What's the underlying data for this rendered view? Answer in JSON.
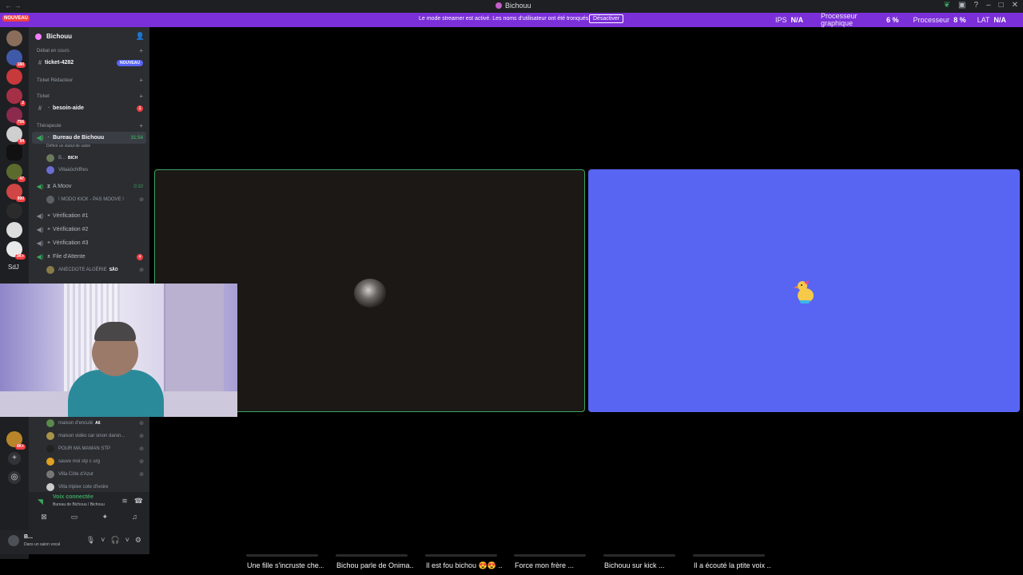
{
  "window": {
    "title": "Bichouu"
  },
  "streamer_bar": {
    "nouveau": "NOUVEAU",
    "message": "Le mode streamer est activé. Les noms d'utilisateur ont été tronqués.",
    "deactivate_label": "Désactiver",
    "stats": [
      {
        "label": "IPS",
        "value": "N/A"
      },
      {
        "label": "Processeur graphique",
        "value": "6 %"
      },
      {
        "label": "Processeur",
        "value": "8 %"
      },
      {
        "label": "LAT",
        "value": "N/A"
      }
    ]
  },
  "servers": {
    "badges": [
      "180",
      "2",
      "756",
      "94",
      "47",
      "990",
      "3K+",
      "4K+"
    ],
    "text_item": "SdJ"
  },
  "guild": {
    "name": "Bichouu",
    "categories": [
      {
        "name": "Débat en cours",
        "channels": [
          {
            "name": "ticket-4282",
            "badge": "NOUVEAU"
          }
        ]
      },
      {
        "name": "Ticket Rédacteur",
        "channels": []
      },
      {
        "name": "Ticket",
        "channels": [
          {
            "name": "besoin-aide",
            "badge": "1"
          }
        ]
      },
      {
        "name": "Thérapeute"
      }
    ],
    "voice": {
      "bureau": {
        "name": "Bureau de Bichouu",
        "time": "31:54",
        "status_hint": "Définir un statut de salon",
        "members": [
          {
            "name": "B...",
            "tag": "BICH"
          },
          {
            "name": "Villaáóchiffres"
          }
        ]
      },
      "amoov": {
        "name": "A Moov",
        "time": "0:10",
        "members": [
          {
            "name": "! MODO KICK - PAS MOOVE !"
          }
        ]
      },
      "verif1": "Vérification #1",
      "verif2": "Vérification #2",
      "verif3": "Vérification #3",
      "file": {
        "name": "File d'Attente",
        "badge": "4",
        "members": [
          {
            "name": "ANECDOTE ALGÉRIE",
            "tag": "SÃO"
          }
        ]
      }
    },
    "more_members": [
      {
        "name": "maison d'enculé",
        "tag": "A6"
      },
      {
        "name": "maison vidéo car sinon daron..."
      },
      {
        "name": "POUR MA MAMAN STP"
      },
      {
        "name": "sauve moi stp c urg"
      },
      {
        "name": "Villa Côte d'Azur"
      },
      {
        "name": "Villa triplex cote d'ivoire"
      }
    ]
  },
  "voice_panel": {
    "title": "Voix connectée",
    "subtitle": "Bureau de Bichouu / Bichouu"
  },
  "user_panel": {
    "name": "B...",
    "status": "Dans un salon vocal"
  },
  "bottom_titles": [
    "Une fille s'incruste che...",
    "Bichou parle de Onima...",
    "Il est fou bichou 😍😍 ...",
    "Force mon frère ...",
    "Bichouu sur kick ...",
    "Il a écouté la ptite voix ..."
  ],
  "colors": {
    "streamer_bar": "#7b2fd8",
    "speaking_border": "#3ba55d",
    "right_tile": "#5865f2",
    "sidebar": "#2b2d31",
    "server_rail": "#1e1f22"
  }
}
